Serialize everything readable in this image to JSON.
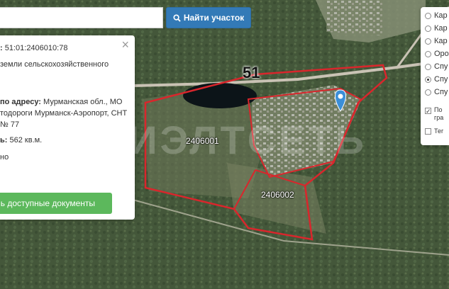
{
  "search": {
    "value": "",
    "button_label": "Найти участок"
  },
  "info": {
    "cadastral_label": ":",
    "cadastral_value": "51:01:2406010:78",
    "category_line": "земли сельскохозяйственного",
    "address_label": "по адресу:",
    "address_line1": "Мурманская обл., МО",
    "address_line2": "тодороги Мурманск-Аэропорт, СНТ",
    "address_line3": "№ 77",
    "area_label": "ь:",
    "area_value": "562 кв.м.",
    "status_fragment": "но",
    "docs_button": "ь доступные документы"
  },
  "layers": {
    "items": [
      {
        "label": "Кар",
        "selected": false
      },
      {
        "label": "Кар",
        "selected": false
      },
      {
        "label": "Кар",
        "selected": false
      },
      {
        "label": "Opo",
        "selected": false
      },
      {
        "label": "Спу",
        "selected": false
      },
      {
        "label": "Спу",
        "selected": true
      },
      {
        "label": "Спу",
        "selected": false
      }
    ],
    "check1_line1": "По",
    "check1_line2": "гра",
    "check1_checked": true,
    "check2_label": "Тег",
    "check2_checked": false
  },
  "map": {
    "road_number": "51",
    "block_1": "2406001",
    "block_2": "2406002",
    "watermark": "РИЭЛТСЕТЬ",
    "boundary_color": "#d9262c",
    "marker_color": "#3b8ed8"
  }
}
